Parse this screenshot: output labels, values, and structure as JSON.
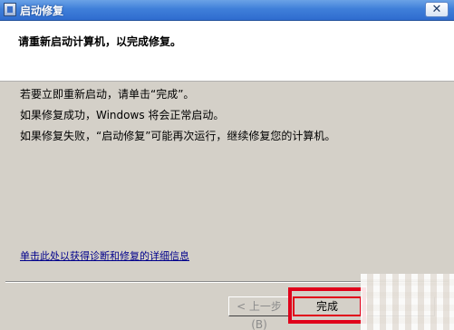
{
  "window": {
    "title": "启动修复",
    "close_symbol": "✕"
  },
  "header": {
    "text": "请重新启动计算机，以完成修复。"
  },
  "body": {
    "lines": [
      "若要立即重新启动，请单击“完成”。",
      "如果修复成功，Windows 将会正常启动。",
      "如果修复失败，“启动修复”可能再次运行，继续修复您的计算机。"
    ],
    "details_link": "单击此处以获得诊断和修复的详细信息"
  },
  "buttons": {
    "prev": "< 上一步 (B)",
    "finish": "完成",
    "cancel": ""
  },
  "colors": {
    "title_bar": "#3f7fd9",
    "dialog_bg": "#d4d0c8",
    "annotation_red": "#e0001a",
    "link": "#00008b"
  },
  "icons": {
    "title": "app-window-icon",
    "close": "close-icon"
  }
}
